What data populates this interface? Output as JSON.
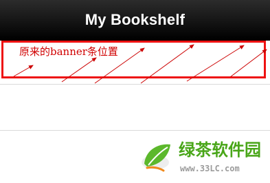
{
  "navbar": {
    "title": "My Bookshelf"
  },
  "banner": {
    "annotation_text": "原来的banner条位置",
    "highlight_color": "#ee1111",
    "arrow_color": "#cc0000"
  },
  "watermark": {
    "name": "绿茶软件园",
    "url": "www.33LC.com",
    "brand_color": "#49a619"
  }
}
